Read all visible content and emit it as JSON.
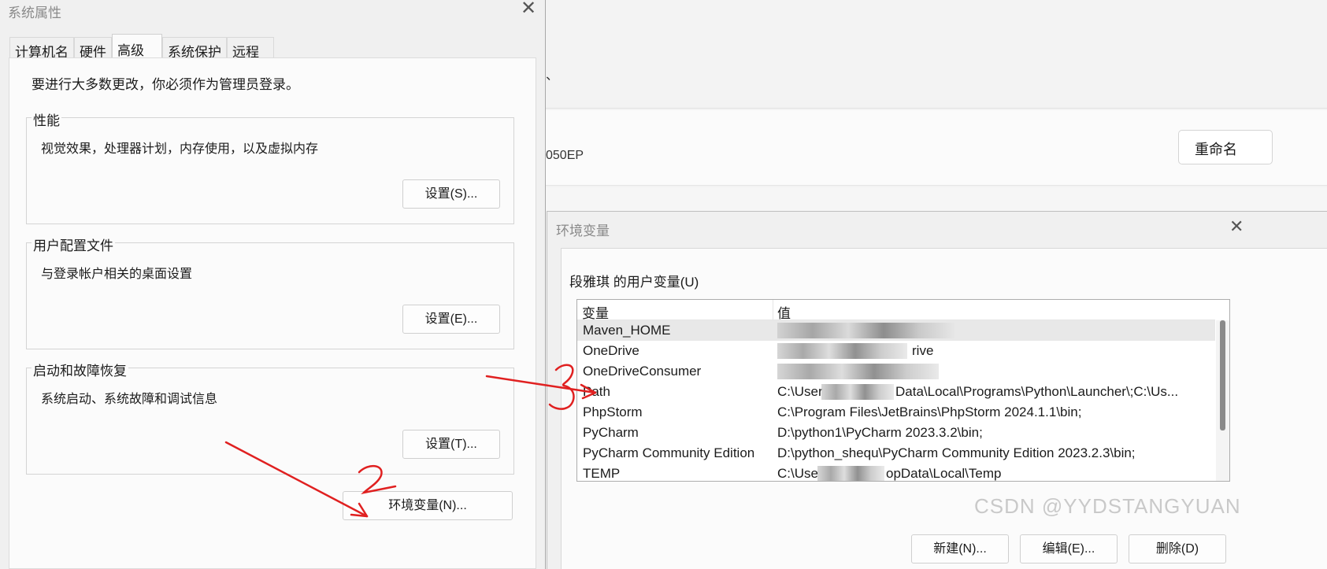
{
  "background_settings": {
    "model_suffix": "050EP",
    "rename_button": "重命名",
    "caret": "、"
  },
  "system_properties": {
    "title": "系统属性",
    "close_glyph": "✕",
    "tabs": [
      "计算机名",
      "硬件",
      "高级",
      "系统保护",
      "远程"
    ],
    "active_tab": "高级",
    "admin_note": "要进行大多数更改，你必须作为管理员登录。",
    "groups": [
      {
        "title": "性能",
        "description": "视觉效果，处理器计划，内存使用，以及虚拟内存",
        "button": "设置(S)..."
      },
      {
        "title": "用户配置文件",
        "description": "与登录帐户相关的桌面设置",
        "button": "设置(E)..."
      },
      {
        "title": "启动和故障恢复",
        "description": "系统启动、系统故障和调试信息",
        "button": "设置(T)..."
      }
    ],
    "env_button": "环境变量(N)..."
  },
  "environment_variables": {
    "title": "环境变量",
    "close_glyph": "✕",
    "user_section_label": "段雅琪 的用户变量(U)",
    "columns": {
      "name": "变量",
      "value": "值"
    },
    "rows": [
      {
        "name": "Maven_HOME",
        "value": "",
        "selected": true
      },
      {
        "name": "OneDrive",
        "value": "rive"
      },
      {
        "name": "OneDriveConsumer",
        "value": ""
      },
      {
        "name": "Path",
        "value": "C:\\User",
        "value_tail": "Data\\Local\\Programs\\Python\\Launcher\\;C:\\Us..."
      },
      {
        "name": "PhpStorm",
        "value": "C:\\Program Files\\JetBrains\\PhpStorm 2024.1.1\\bin;"
      },
      {
        "name": "PyCharm",
        "value": "D:\\python1\\PyCharm 2023.3.2\\bin;"
      },
      {
        "name": "PyCharm Community Edition",
        "value": "D:\\python_shequ\\PyCharm Community Edition 2023.2.3\\bin;"
      },
      {
        "name": "TEMP",
        "value": "C:\\Use",
        "value_tail": "opData\\Local\\Temp"
      }
    ],
    "buttons": {
      "new": "新建(N)...",
      "edit": "编辑(E)...",
      "delete": "删除(D)"
    }
  },
  "watermark": "CSDN @YYDSTANGYUAN",
  "annotations": {
    "step2": "2",
    "step3": "3",
    "color": "#e02020"
  },
  "colors": {
    "dialog_bg": "#f0f0f0",
    "panel_bg": "#fbfbfb",
    "selection": "#e8e8e8",
    "annotation_red": "#e02020"
  }
}
